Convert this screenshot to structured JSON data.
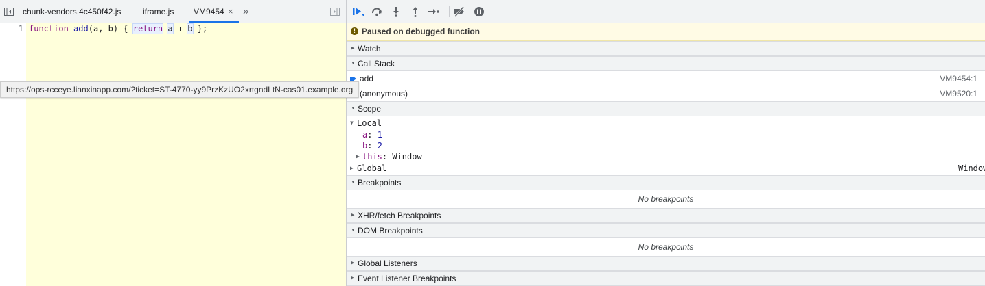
{
  "editor": {
    "tabs": [
      {
        "label": "chunk-vendors.4c450f42.js"
      },
      {
        "label": "iframe.js"
      },
      {
        "label": "VM9454"
      }
    ],
    "close_glyph": "×",
    "more_tabs_glyph": "»",
    "line_number": "1",
    "code": {
      "kw_function": "function",
      "fn_name": "add",
      "params_open": "(",
      "param_a": "a",
      "comma": ", ",
      "param_b": "b",
      "params_close": ") { ",
      "kw_return": "return",
      "body_space": " ",
      "expr_a": "a",
      "plus": " + ",
      "expr_b": "b",
      "end": " };"
    },
    "tooltip_url": "https://ops-rcceye.lianxinapp.com/?ticket=ST-4770-yy9PrzKzUO2xrtgndLtN-cas01.example.org"
  },
  "debugger": {
    "paused_message": "Paused on debugged function",
    "sections": {
      "watch": "Watch",
      "call_stack": "Call Stack",
      "scope": "Scope",
      "breakpoints": "Breakpoints",
      "xhr_breakpoints": "XHR/fetch Breakpoints",
      "dom_breakpoints": "DOM Breakpoints",
      "global_listeners": "Global Listeners",
      "event_listener_breakpoints": "Event Listener Breakpoints"
    },
    "call_stack": [
      {
        "name": "add",
        "location": "VM9454:1"
      },
      {
        "name": "(anonymous)",
        "location": "VM9520:1"
      }
    ],
    "scope": {
      "local_label": "Local",
      "vars": [
        {
          "name": "a",
          "value": "1"
        },
        {
          "name": "b",
          "value": "2"
        }
      ],
      "this_name": "this",
      "this_value": "Window",
      "global_label": "Global",
      "global_value": "Window"
    },
    "no_breakpoints": "No breakpoints",
    "no_dom_breakpoints": "No breakpoints"
  },
  "colors": {
    "accent": "#1a73e8",
    "paused_bg": "#fffbe5",
    "editor_bg": "#ffffdb"
  }
}
